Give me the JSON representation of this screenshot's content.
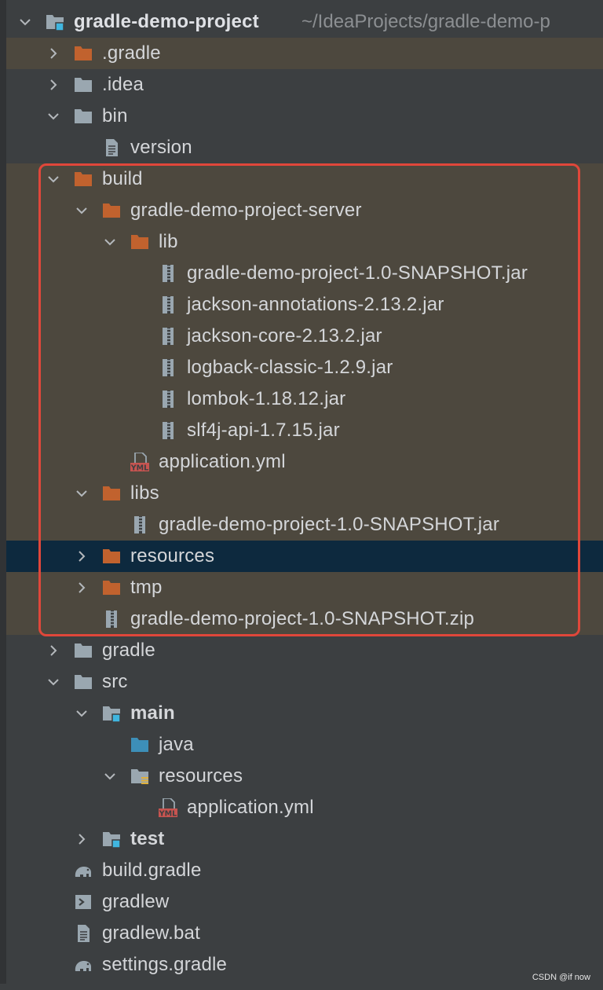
{
  "tree": {
    "root": {
      "name": "gradle-demo-project",
      "path": "~/IdeaProjects/gradle-demo-p"
    },
    "rows": [
      {
        "label": ".gradle",
        "icon": "folder-orange-icon",
        "depth": 1,
        "toggle": "collapsed",
        "excluded": true
      },
      {
        "label": ".idea",
        "icon": "folder-gray-icon",
        "depth": 1,
        "toggle": "collapsed"
      },
      {
        "label": "bin",
        "icon": "folder-gray-icon",
        "depth": 1,
        "toggle": "expanded"
      },
      {
        "label": "version",
        "icon": "text-file-icon",
        "depth": 2,
        "toggle": "none"
      },
      {
        "label": "build",
        "icon": "folder-orange-icon",
        "depth": 1,
        "toggle": "expanded",
        "excluded": true
      },
      {
        "label": "gradle-demo-project-server",
        "icon": "folder-orange-icon",
        "depth": 2,
        "toggle": "expanded",
        "excluded": true
      },
      {
        "label": "lib",
        "icon": "folder-orange-icon",
        "depth": 3,
        "toggle": "expanded",
        "excluded": true
      },
      {
        "label": "gradle-demo-project-1.0-SNAPSHOT.jar",
        "icon": "archive-icon",
        "depth": 4,
        "toggle": "none",
        "excluded": true
      },
      {
        "label": "jackson-annotations-2.13.2.jar",
        "icon": "archive-icon",
        "depth": 4,
        "toggle": "none",
        "excluded": true
      },
      {
        "label": "jackson-core-2.13.2.jar",
        "icon": "archive-icon",
        "depth": 4,
        "toggle": "none",
        "excluded": true
      },
      {
        "label": "logback-classic-1.2.9.jar",
        "icon": "archive-icon",
        "depth": 4,
        "toggle": "none",
        "excluded": true
      },
      {
        "label": "lombok-1.18.12.jar",
        "icon": "archive-icon",
        "depth": 4,
        "toggle": "none",
        "excluded": true
      },
      {
        "label": "slf4j-api-1.7.15.jar",
        "icon": "archive-icon",
        "depth": 4,
        "toggle": "none",
        "excluded": true
      },
      {
        "label": "application.yml",
        "icon": "yml-file-icon",
        "depth": 3,
        "toggle": "none",
        "excluded": true
      },
      {
        "label": "libs",
        "icon": "folder-orange-icon",
        "depth": 2,
        "toggle": "expanded",
        "excluded": true
      },
      {
        "label": "gradle-demo-project-1.0-SNAPSHOT.jar",
        "icon": "archive-icon",
        "depth": 3,
        "toggle": "none",
        "excluded": true
      },
      {
        "label": "resources",
        "icon": "folder-orange-icon",
        "depth": 2,
        "toggle": "collapsed",
        "selected": true
      },
      {
        "label": "tmp",
        "icon": "folder-orange-icon",
        "depth": 2,
        "toggle": "collapsed",
        "excluded": true
      },
      {
        "label": "gradle-demo-project-1.0-SNAPSHOT.zip",
        "icon": "archive-icon",
        "depth": 2,
        "toggle": "none",
        "excluded": true
      },
      {
        "label": "gradle",
        "icon": "folder-gray-icon",
        "depth": 1,
        "toggle": "collapsed"
      },
      {
        "label": "src",
        "icon": "folder-gray-icon",
        "depth": 1,
        "toggle": "expanded"
      },
      {
        "label": "main",
        "icon": "module-folder-icon",
        "depth": 2,
        "toggle": "expanded",
        "bold": true
      },
      {
        "label": "java",
        "icon": "source-folder-icon",
        "depth": 3,
        "toggle": "none"
      },
      {
        "label": "resources",
        "icon": "resources-folder-icon",
        "depth": 3,
        "toggle": "expanded"
      },
      {
        "label": "application.yml",
        "icon": "yml-file-icon",
        "depth": 4,
        "toggle": "none"
      },
      {
        "label": "test",
        "icon": "module-folder-icon",
        "depth": 2,
        "toggle": "collapsed",
        "bold": true
      },
      {
        "label": "build.gradle",
        "icon": "gradle-elephant-icon",
        "depth": 1,
        "toggle": "none"
      },
      {
        "label": "gradlew",
        "icon": "shell-script-icon",
        "depth": 1,
        "toggle": "none"
      },
      {
        "label": "gradlew.bat",
        "icon": "text-file-icon",
        "depth": 1,
        "toggle": "none"
      },
      {
        "label": "settings.gradle",
        "icon": "gradle-elephant-icon",
        "depth": 1,
        "toggle": "none"
      }
    ]
  },
  "watermark": "CSDN @if now",
  "colors": {
    "background": "#3c3f41",
    "excluded_row": "#4d483e",
    "selected_row": "#0d293e",
    "excluded_folder": "#c1622e",
    "folder": "#9aa7b0",
    "source_folder": "#3d8fb8",
    "module_marker": "#40b6e0",
    "highlight_border": "#e0473a"
  }
}
